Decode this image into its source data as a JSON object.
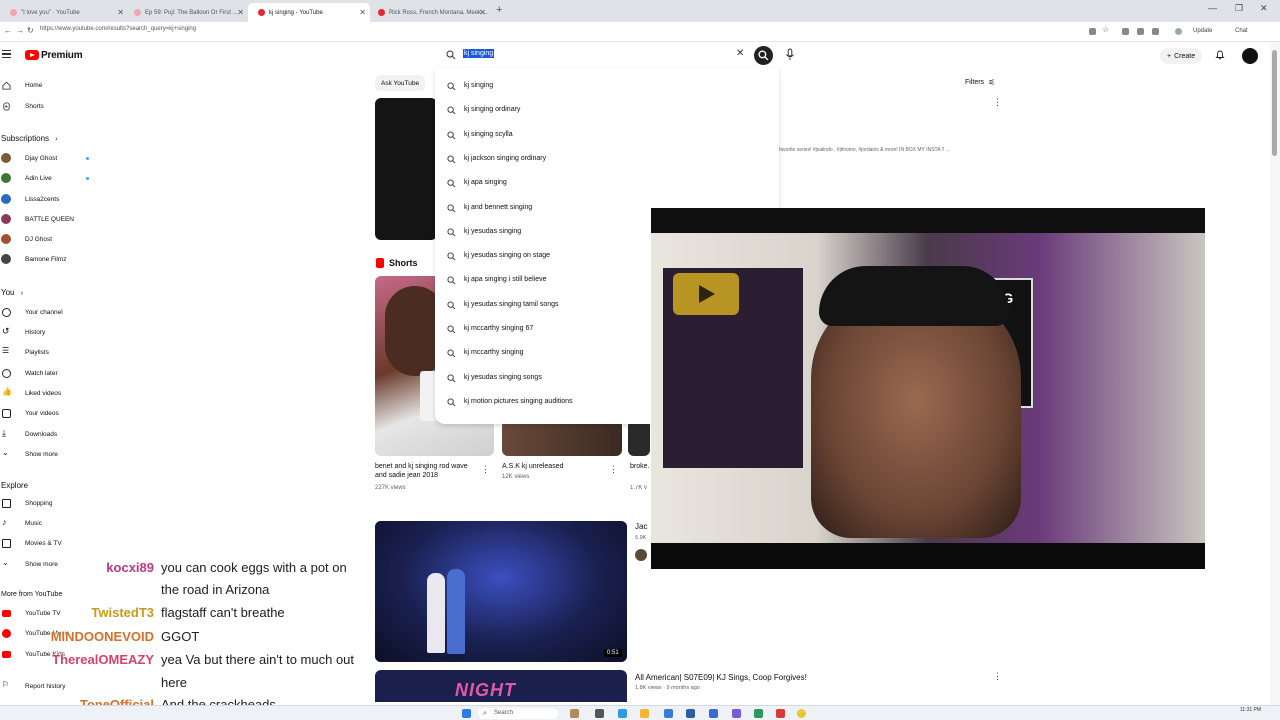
{
  "browser": {
    "tabs": [
      {
        "label": "\"I love you\" · YouTube"
      },
      {
        "label": "Ep 59: Puji: The Balloon Or First ..."
      },
      {
        "label": "kj singing - YouTube"
      },
      {
        "label": "Rick Ross, French Montana, Meek ..."
      }
    ],
    "url": "https://www.youtube.com/results?search_query=kj+singing",
    "update_label": "Update",
    "chat_label": "Chat"
  },
  "header": {
    "brand": "Premium",
    "create_label": "Create"
  },
  "search": {
    "query": "kj singing",
    "suggestions": [
      "kj singing",
      "kj singing ordinary",
      "kj singing scylla",
      "kj jackson singing ordinary",
      "kj apa singing",
      "kj and bennett singing",
      "kj yesudas singing",
      "kj yesudas singing on stage",
      "kj apa singing i still believe",
      "kj yesudas singing tamil songs",
      "kj mccarthy singing 67",
      "kj mccarthy singing",
      "kj yesudas singing songs",
      "kj motion pictures singing auditions"
    ]
  },
  "sidebar": {
    "home": "Home",
    "shorts": "Shorts",
    "subscriptions_header": "Subscriptions",
    "subscriptions": [
      {
        "name": "Djay Ghost",
        "color": "#7a5a3c",
        "dot": true
      },
      {
        "name": "Adin Live",
        "color": "#3b7a2e",
        "dot": true
      },
      {
        "name": "Lissa2cents",
        "color": "#2a6bc1",
        "dot": false
      },
      {
        "name": "BATTLE QUEEN",
        "color": "#8a3a5c",
        "dot": false
      },
      {
        "name": "DJ Ghost",
        "color": "#a0522d",
        "dot": false
      },
      {
        "name": "Bamone Filmz",
        "color": "#444444",
        "dot": false
      }
    ],
    "you_header": "You",
    "you_items": [
      "Your channel",
      "History",
      "Playlists",
      "Watch later",
      "Liked videos",
      "Your videos",
      "Downloads",
      "Show more"
    ],
    "explore_header": "Explore",
    "explore_items": [
      "Shopping",
      "Music",
      "Movies & TV",
      "Show more"
    ],
    "more_header": "More from YouTube",
    "more_items": [
      "YouTube TV",
      "YouTube Music",
      "YouTube Kids"
    ],
    "report_history": "Report history"
  },
  "main": {
    "ask_chip": "Ask YouTube",
    "filters_label": "Filters",
    "top_desc": "favorite series! #jsalindo , #jlmomo, #jordanis & more! IN BOX MY INSTA !! ...",
    "shorts_header": "Shorts",
    "shorts": [
      {
        "title": "benet and kj singing rod wave and sadie jean 2018",
        "views": "227K views"
      },
      {
        "title": "A.S.K kj unreleased",
        "views": "12K views"
      },
      {
        "title": "broke...",
        "views": "1.7K v"
      }
    ],
    "video1": {
      "duration": "0:51",
      "channel_partial": "Jac",
      "meta_partial": "5.9K"
    },
    "video2": {
      "title": "All American| S07E09| KJ Sings, Coop Forgives!",
      "meta": "1.8K views · 9 months ago",
      "thumb_text": "NIGHT"
    }
  },
  "chat": [
    {
      "name": "kocxi89",
      "color": "#c0397e",
      "lines": [
        "you can cook eggs with a pot on",
        "the road in Arizona"
      ]
    },
    {
      "name": "TwistedT3",
      "color": "#c99a1a",
      "lines": [
        "flagstaff can't breathe"
      ]
    },
    {
      "name": "MINDOONEVOID",
      "color": "#d4702a",
      "lines": [
        "GGOT"
      ]
    },
    {
      "name": "TherealOMEAZY",
      "color": "#d4426a",
      "lines": [
        "yea Va but there ain't to much out",
        "here"
      ]
    },
    {
      "name": "ToneOfficial",
      "color": "#d4702a",
      "lines": [
        "And the crackheads"
      ]
    }
  ],
  "taskbar": {
    "search_label": "Search",
    "time": "11:31 PM"
  },
  "colors": {
    "yt_red": "#ff0000",
    "highlight": "#1a5ad8"
  }
}
